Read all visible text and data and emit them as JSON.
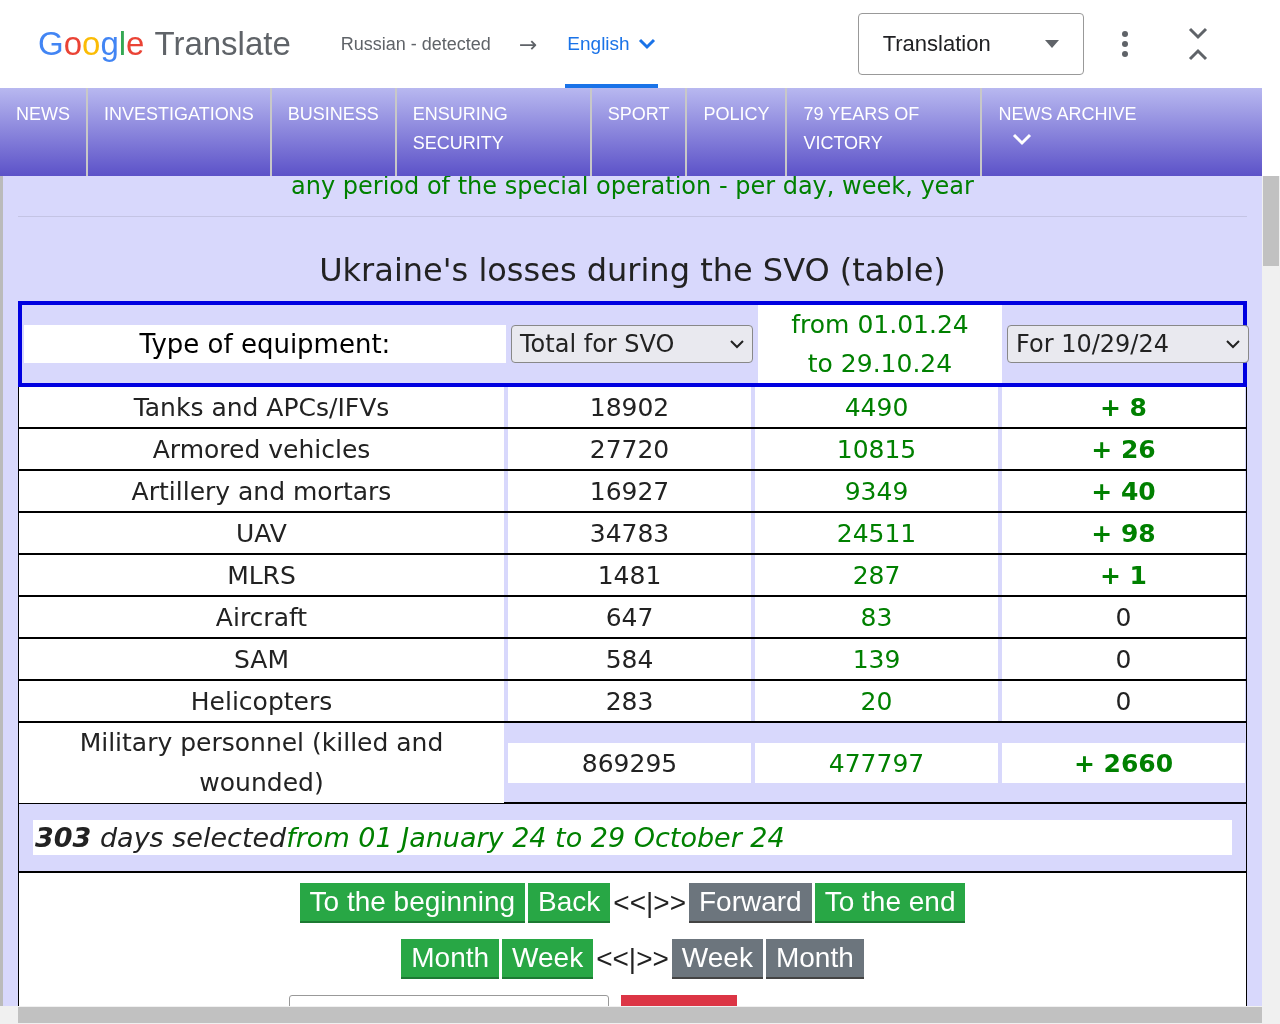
{
  "translate_bar": {
    "logo_brand": "Google",
    "logo_product": "Translate",
    "source_language": "Russian - detected",
    "arrow": "→",
    "target_language": "English",
    "mode": "Translation"
  },
  "nav": [
    {
      "label": "NEWS",
      "has_menu": false
    },
    {
      "label": "INVESTIGATIONS",
      "has_menu": false
    },
    {
      "label": "BUSINESS",
      "has_menu": false
    },
    {
      "label": "ENSURING SECURITY",
      "has_menu": false
    },
    {
      "label": "SPORT",
      "has_menu": false
    },
    {
      "label": "POLICY",
      "has_menu": false
    },
    {
      "label": "79 YEARS OF VICTORY",
      "has_menu": false
    },
    {
      "label": "NEWS ARCHIVE",
      "has_menu": true
    }
  ],
  "subtitle": "any period of the special operation - per day, week, year",
  "title": "Ukraine's losses during the SVO (table)",
  "table": {
    "header": {
      "type_label": "Type of equipment:",
      "total_select": "Total for SVO",
      "period": "from 01.01.24 to 29.10.24",
      "day_select": "For 10/29/24"
    },
    "rows": [
      {
        "name": "Tanks and APCs/IFVs",
        "total": "18902",
        "period": "4490",
        "day": "+ 8",
        "increase": true
      },
      {
        "name": "Armored vehicles",
        "total": "27720",
        "period": "10815",
        "day": "+ 26",
        "increase": true
      },
      {
        "name": "Artillery and mortars",
        "total": "16927",
        "period": "9349",
        "day": "+ 40",
        "increase": true
      },
      {
        "name": "UAV",
        "total": "34783",
        "period": "24511",
        "day": "+ 98",
        "increase": true
      },
      {
        "name": "MLRS",
        "total": "1481",
        "period": "287",
        "day": "+ 1",
        "increase": true
      },
      {
        "name": "Aircraft",
        "total": "647",
        "period": "83",
        "day": "0",
        "increase": false
      },
      {
        "name": "SAM",
        "total": "584",
        "period": "139",
        "day": "0",
        "increase": false
      },
      {
        "name": "Helicopters",
        "total": "283",
        "period": "20",
        "day": "0",
        "increase": false
      },
      {
        "name": "Military personnel (killed and wounded)",
        "total": "869295",
        "period": "477797",
        "day": "+ 2660",
        "increase": true
      }
    ],
    "summary": {
      "days": "**303** days selected",
      "range": "from 01 January 24 to 29 October 24"
    }
  },
  "nav_rows": [
    [
      {
        "label": "To the beginning",
        "disabled": false
      },
      {
        "label": "Back",
        "disabled": false
      },
      {
        "label": "<<|>>",
        "kind": "separator"
      },
      {
        "label": "Forward",
        "disabled": true
      },
      {
        "label": "To the end",
        "disabled": false
      }
    ],
    [
      {
        "label": "Month",
        "disabled": false
      },
      {
        "label": "Week",
        "disabled": false
      },
      {
        "label": "<<|>>",
        "kind": "separator"
      },
      {
        "label": "Week",
        "disabled": true
      },
      {
        "label": "Month",
        "disabled": true
      }
    ]
  ]
}
